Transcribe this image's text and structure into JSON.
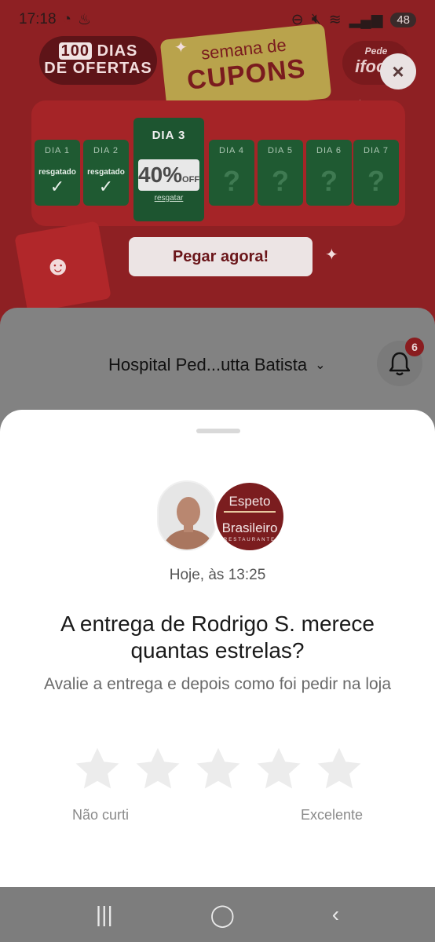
{
  "status_bar": {
    "time": "17:18",
    "battery": "48"
  },
  "promo": {
    "badge_num": "100",
    "badge_line1": "DIAS",
    "badge_line2": "DE OFERTAS",
    "semana_line1": "semana de",
    "semana_line2": "CUPONS",
    "ifood_line1": "Pede",
    "ifood_line2": "ifood",
    "close_label": "×",
    "coupons": [
      {
        "day": "DIA 1",
        "status": "resgatado",
        "check": "✓"
      },
      {
        "day": "DIA 2",
        "status": "resgatado",
        "check": "✓"
      },
      {
        "day": "DIA 3",
        "discount": "40%",
        "discount_unit": "OFF",
        "action": "resgatar"
      },
      {
        "day": "DIA 4",
        "mystery": "?"
      },
      {
        "day": "DIA 5",
        "mystery": "?"
      },
      {
        "day": "DIA 6",
        "mystery": "?"
      },
      {
        "day": "DIA 7",
        "mystery": "?"
      }
    ],
    "cta_label": "Pegar agora!"
  },
  "header": {
    "address": "Hospital Ped...utta Batista",
    "notification_count": "6"
  },
  "rating_sheet": {
    "store_name_line1": "Espeto",
    "store_name_line2": "Brasileiro",
    "store_tagline": "RESTAURANTE",
    "timestamp": "Hoje, às 13:25",
    "title": "A entrega de Rodrigo S. merece quantas estrelas?",
    "subtitle": "Avalie a entrega e depois como foi pedir na loja",
    "stars_count": 5,
    "label_low": "Não curti",
    "label_high": "Excelente"
  },
  "nav_bar": {
    "recents": "|||",
    "home": "◯",
    "back": "‹"
  },
  "colors": {
    "promo_red": "#8e2023",
    "coupon_green": "#1f5a32",
    "star_gray": "#ececec"
  }
}
